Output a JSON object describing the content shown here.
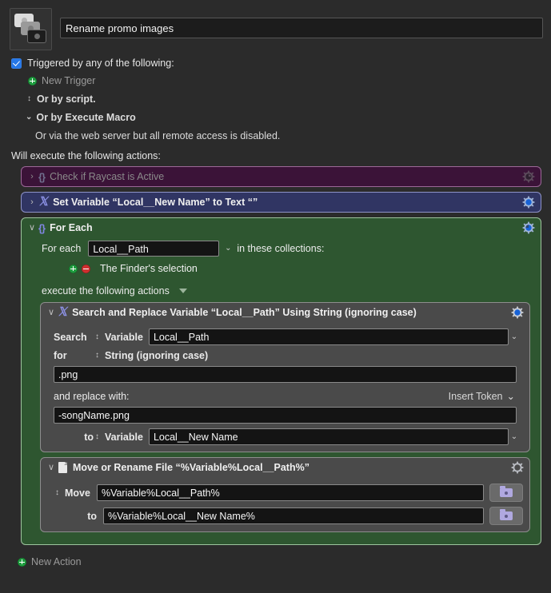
{
  "macro": {
    "icon_name": "stacked-images-icon",
    "name": "Rename promo images"
  },
  "triggers": {
    "enabled": true,
    "label": "Triggered by any of the following:",
    "new_trigger_label": "New Trigger",
    "or_by_script": "Or by script.",
    "or_by_execute_macro": "Or by Execute Macro",
    "web_server_note": "Or via the web server but all remote access is disabled."
  },
  "actions_header": "Will execute the following actions:",
  "actions": [
    {
      "title": "Check if Raycast is Active",
      "icon": "braces-icon",
      "color": "#3b1338",
      "border": "#9c6898",
      "disclosure": "›",
      "disabled": true
    },
    {
      "title": "Set Variable “Local__New Name” to Text “”",
      "icon": "script-x-icon",
      "color": "#303563",
      "border": "#8e93c8",
      "disclosure": "›",
      "disabled": false
    }
  ],
  "for_each": {
    "title": "For Each",
    "icon": "braces-icon",
    "color": "#2e5630",
    "border": "#9ec49e",
    "disclosure": "∨",
    "for_each_label": "For each",
    "variable_value": "Local__Path",
    "in_collections_label": "in these collections:",
    "collection_item": "The Finder's selection",
    "execute_label": "execute the following actions"
  },
  "search_replace": {
    "title": "Search and Replace Variable “Local__Path” Using String (ignoring case)",
    "icon": "script-x-icon",
    "disclosure": "∨",
    "search_label": "Search",
    "search_source_label": "Variable",
    "search_variable_value": "Local__Path",
    "for_label": "for",
    "for_mode_label": "String (ignoring case)",
    "search_text_value": ".png",
    "replace_label": "and replace with:",
    "insert_token_label": "Insert Token",
    "replace_text_value": "-songName.png",
    "to_label": "to",
    "to_source_label": "Variable",
    "to_variable_value": "Local__New Name"
  },
  "move_rename": {
    "title": "Move or Rename File “%Variable%Local__Path%”",
    "icon": "document-icon",
    "disclosure": "∨",
    "move_label": "Move",
    "move_value": "%Variable%Local__Path%",
    "to_label": "to",
    "to_value": "%Variable%Local__New Name%",
    "browse_icon": "folder-icon"
  },
  "footer": {
    "new_action_label": "New Action"
  },
  "colors": {
    "background": "#2b2b2b",
    "accent_blue": "#2577e8",
    "green_badge": "#1f9d3f",
    "red_badge": "#cf3030",
    "purple_action": "#3b1338",
    "blue_action": "#303563",
    "green_action": "#2e5630",
    "nested_action": "#4a4a4a"
  }
}
